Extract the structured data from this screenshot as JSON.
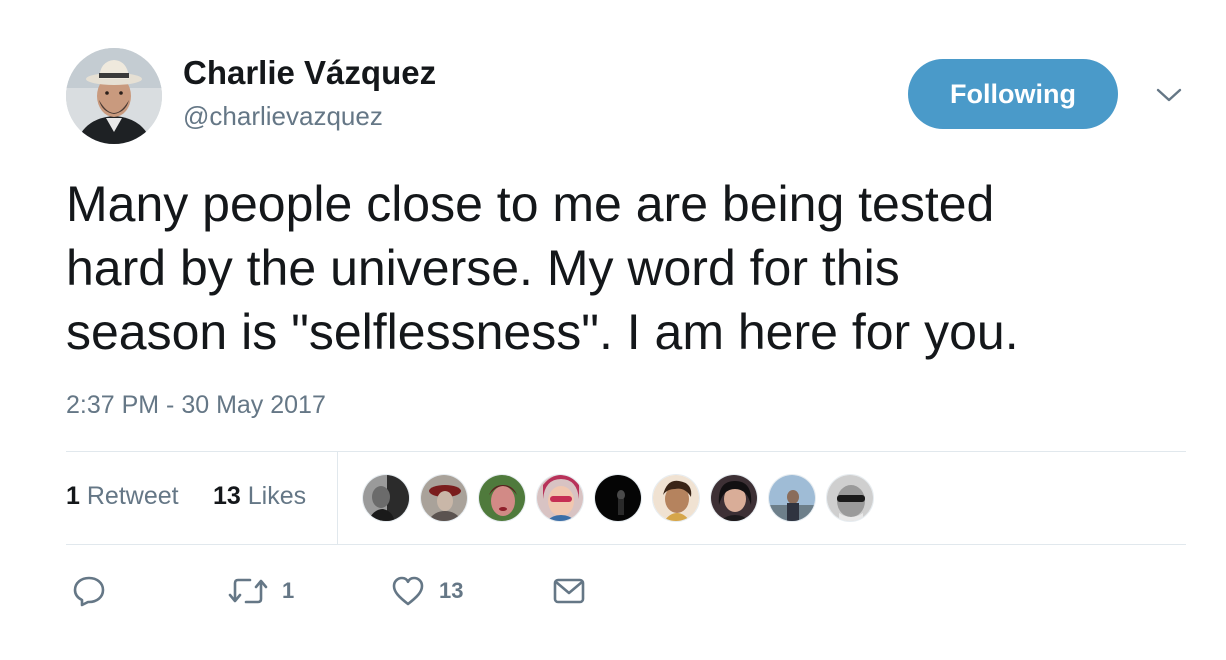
{
  "author": {
    "name": "Charlie Vázquez",
    "handle": "@charlievazquez"
  },
  "follow_button": {
    "label": "Following",
    "color": "#4a9ac9"
  },
  "menu": {
    "icon": "chevron-down-icon"
  },
  "tweet": {
    "text_lines": [
      "Many people close to me are being tested",
      "hard by the universe. My word for this",
      "season is \"selflessness\". I am here for you."
    ],
    "timestamp": "2:37 PM - 30 May 2017"
  },
  "stats": {
    "retweets_count": "1",
    "retweets_label": "Retweet",
    "likes_count": "13",
    "likes_label": "Likes"
  },
  "liked_by": [
    {
      "icon": "user-avatar"
    },
    {
      "icon": "user-avatar"
    },
    {
      "icon": "user-avatar"
    },
    {
      "icon": "user-avatar"
    },
    {
      "icon": "user-avatar"
    },
    {
      "icon": "user-avatar"
    },
    {
      "icon": "user-avatar"
    },
    {
      "icon": "user-avatar"
    },
    {
      "icon": "user-avatar"
    }
  ],
  "actions": {
    "reply": {
      "icon": "reply-icon"
    },
    "retweet": {
      "icon": "retweet-icon",
      "count": "1"
    },
    "like": {
      "icon": "heart-icon",
      "count": "13"
    },
    "dm": {
      "icon": "envelope-icon"
    }
  },
  "colors": {
    "text": "#14171a",
    "secondary": "#657786",
    "divider": "#e1e8ed"
  }
}
